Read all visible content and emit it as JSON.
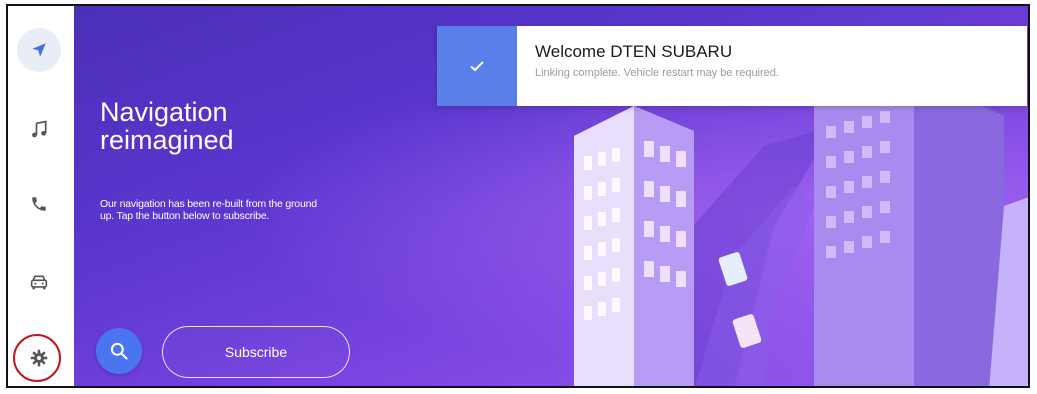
{
  "sidebar": {
    "items": [
      {
        "icon": "navigation-arrow-icon",
        "active": true
      },
      {
        "icon": "music-note-icon",
        "active": false
      },
      {
        "icon": "phone-icon",
        "active": false
      },
      {
        "icon": "car-icon",
        "active": false
      },
      {
        "icon": "settings-gear-icon",
        "active": false
      }
    ]
  },
  "hero": {
    "title_line1": "Navigation",
    "title_line2": "reimagined",
    "description": "Our navigation has been re-built from the ground up. Tap the button below to subscribe.",
    "subscribe_label": "Subscribe",
    "search_icon": "search-icon"
  },
  "toast": {
    "title": "Welcome DTEN SUBARU",
    "message": "Linking complete. Vehicle restart may be required.",
    "icon": "check-icon"
  },
  "colors": {
    "accent_blue": "#5b7fe8",
    "search_blue": "#4b74f0",
    "hero_purple": "#5b36cf",
    "highlight_red": "#c0161e"
  }
}
